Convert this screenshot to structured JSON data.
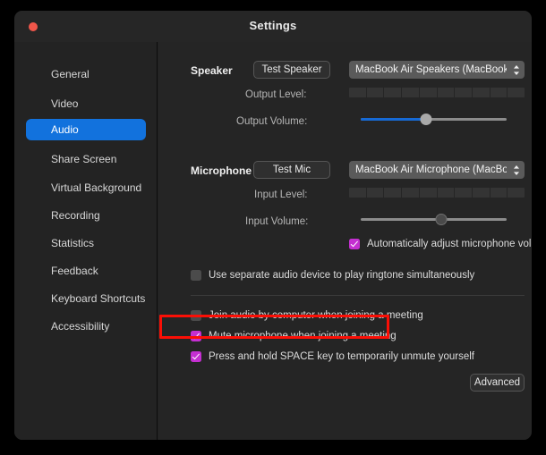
{
  "window": {
    "title": "Settings",
    "close_button_label": "Close",
    "accent_color": "#1272dd",
    "checkbox_checked_color": "#c42fd1",
    "highlight_color": "#fb0f06",
    "background_color": "#232323"
  },
  "sidebar": {
    "items": [
      {
        "label": "General",
        "selected": false
      },
      {
        "label": "Video",
        "selected": false
      },
      {
        "label": "Audio",
        "selected": true
      },
      {
        "label": "Share Screen",
        "selected": false
      },
      {
        "label": "Virtual Background",
        "selected": false
      },
      {
        "label": "Recording",
        "selected": false
      },
      {
        "label": "Statistics",
        "selected": false
      },
      {
        "label": "Feedback",
        "selected": false
      },
      {
        "label": "Keyboard Shortcuts",
        "selected": false
      },
      {
        "label": "Accessibility",
        "selected": false
      }
    ]
  },
  "audio": {
    "speaker": {
      "section_label": "Speaker",
      "test_button": "Test Speaker",
      "device": "MacBook Air Speakers (MacBook Air S...",
      "output_level_label": "Output Level:",
      "output_volume_label": "Output Volume:",
      "output_volume_percent": 45,
      "level_segments": 10
    },
    "microphone": {
      "section_label": "Microphone",
      "test_button": "Test Mic",
      "device": "MacBook Air Microphone (MacBook Air...",
      "input_level_label": "Input Level:",
      "input_volume_label": "Input Volume:",
      "input_volume_percent": 55,
      "level_segments": 10,
      "auto_adjust": {
        "label": "Automatically adjust microphone volume",
        "checked": true
      }
    },
    "options": [
      {
        "label": "Use separate audio device to play ringtone simultaneously",
        "checked": false,
        "highlighted": false
      },
      {
        "label": "Join audio by computer when joining a meeting",
        "checked": false,
        "highlighted": false
      },
      {
        "label": "Mute microphone when joining a meeting",
        "checked": true,
        "highlighted": true
      },
      {
        "label": "Press and hold SPACE key to temporarily unmute yourself",
        "checked": true,
        "highlighted": false
      }
    ],
    "advanced_button": "Advanced"
  }
}
